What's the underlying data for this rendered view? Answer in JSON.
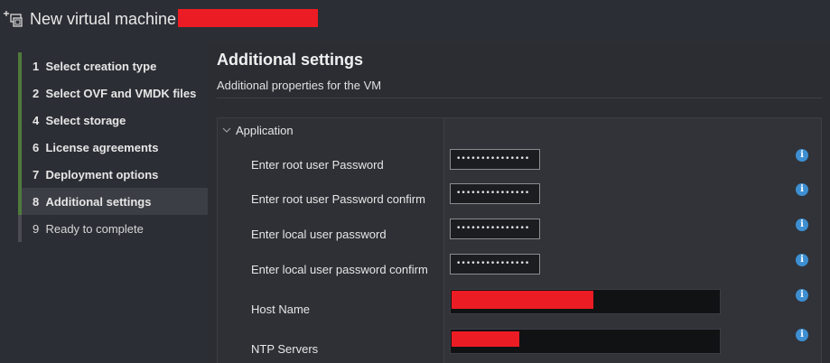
{
  "window": {
    "title": "New virtual machine -",
    "icon": "new-vm-icon"
  },
  "sidebar": {
    "steps": [
      {
        "number": "1",
        "label": "Select creation type",
        "state": "done"
      },
      {
        "number": "2",
        "label": "Select OVF and VMDK files",
        "state": "done"
      },
      {
        "number": "4",
        "label": "Select storage",
        "state": "done"
      },
      {
        "number": "6",
        "label": "License agreements",
        "state": "done"
      },
      {
        "number": "7",
        "label": "Deployment options",
        "state": "done"
      },
      {
        "number": "8",
        "label": "Additional settings",
        "state": "active"
      },
      {
        "number": "9",
        "label": "Ready to complete",
        "state": "pending"
      }
    ]
  },
  "main": {
    "title": "Additional settings",
    "subtitle": "Additional properties for the VM",
    "group": {
      "label": "Application",
      "icon": "chevron-down-icon"
    },
    "properties": [
      {
        "label": "Enter root user Password",
        "type": "password",
        "value": "•••••••••••••••"
      },
      {
        "label": "Enter root user Password confirm",
        "type": "password",
        "value": "•••••••••••••••"
      },
      {
        "label": "Enter local user password",
        "type": "password",
        "value": "•••••••••••••••"
      },
      {
        "label": "Enter local user password confirm",
        "type": "password",
        "value": "•••••••••••••••"
      },
      {
        "label": "Host Name",
        "type": "text",
        "value": ""
      },
      {
        "label": "NTP Servers",
        "type": "text",
        "value": ""
      }
    ],
    "info_icon": "i"
  },
  "colors": {
    "background": "#2b2d33",
    "step_complete_bar": "#4f7a3c",
    "info_icon": "#3d8fd1",
    "redaction": "#ec1c24"
  }
}
